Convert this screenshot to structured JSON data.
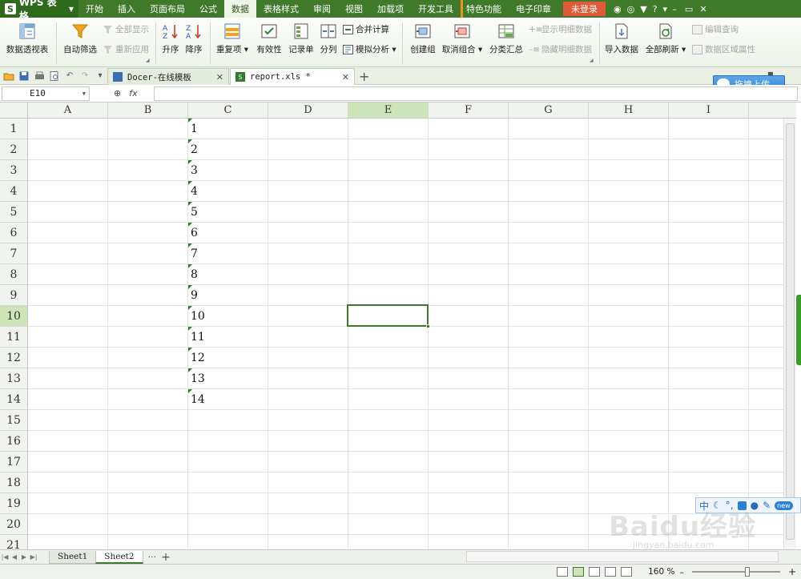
{
  "colors": {
    "accent": "#3f7a2a",
    "selection_header": "#cde5b9",
    "login_badge": "#e05a3a"
  },
  "menubar": {
    "app_label": "WPS 表格",
    "app_logo": "S",
    "items": [
      "开始",
      "插入",
      "页面布局",
      "公式",
      "数据",
      "表格样式",
      "审阅",
      "视图",
      "加载项",
      "开发工具",
      "特色功能",
      "电子印章"
    ],
    "login": "未登录",
    "help": "?"
  },
  "ribbon": {
    "pivot": "数据透视表",
    "autofilter": "自动筛选",
    "show_all": "全部显示",
    "reapply": "重新应用",
    "sort_asc": "升序",
    "sort_desc": "降序",
    "duplicates": "重复项",
    "validity": "有效性",
    "record": "记录单",
    "split": "分列",
    "consolidate": "合并计算",
    "what_if": "模拟分析",
    "group": "创建组",
    "ungroup": "取消组合",
    "subtotal": "分类汇总",
    "show_detail": "显示明细数据",
    "hide_detail": "隐藏明细数据",
    "import": "导入数据",
    "refresh_all": "全部刷新",
    "edit_query": "编辑查询",
    "range_props": "数据区域属性"
  },
  "tabs": [
    {
      "label": "Docer-在线模板"
    },
    {
      "label": "report.xls *"
    }
  ],
  "upload_label": "拖拽上传",
  "formula_bar": {
    "name_box": "E10",
    "fx": "fx",
    "formula": ""
  },
  "grid": {
    "columns": [
      "A",
      "B",
      "C",
      "D",
      "E",
      "F",
      "G",
      "H",
      "I"
    ],
    "rows": [
      "1",
      "2",
      "3",
      "4",
      "5",
      "6",
      "7",
      "8",
      "9",
      "10",
      "11",
      "12",
      "13",
      "14",
      "15",
      "16",
      "17",
      "18",
      "19",
      "20",
      "21"
    ],
    "selected_column": "E",
    "selected_row": "10",
    "column_c_values": [
      "1",
      "2",
      "3",
      "4",
      "5",
      "6",
      "7",
      "8",
      "9",
      "10",
      "11",
      "12",
      "13",
      "14"
    ]
  },
  "ime": {
    "mode": "中",
    "badge": "new"
  },
  "sheets": [
    {
      "label": "Sheet1"
    },
    {
      "label": "Sheet2"
    }
  ],
  "sheet_more": "···",
  "add_sheet": "+",
  "status": {
    "zoom": "160 %"
  },
  "watermark": {
    "text": "Baidu经验",
    "sub": "jingyan.baidu.com"
  }
}
